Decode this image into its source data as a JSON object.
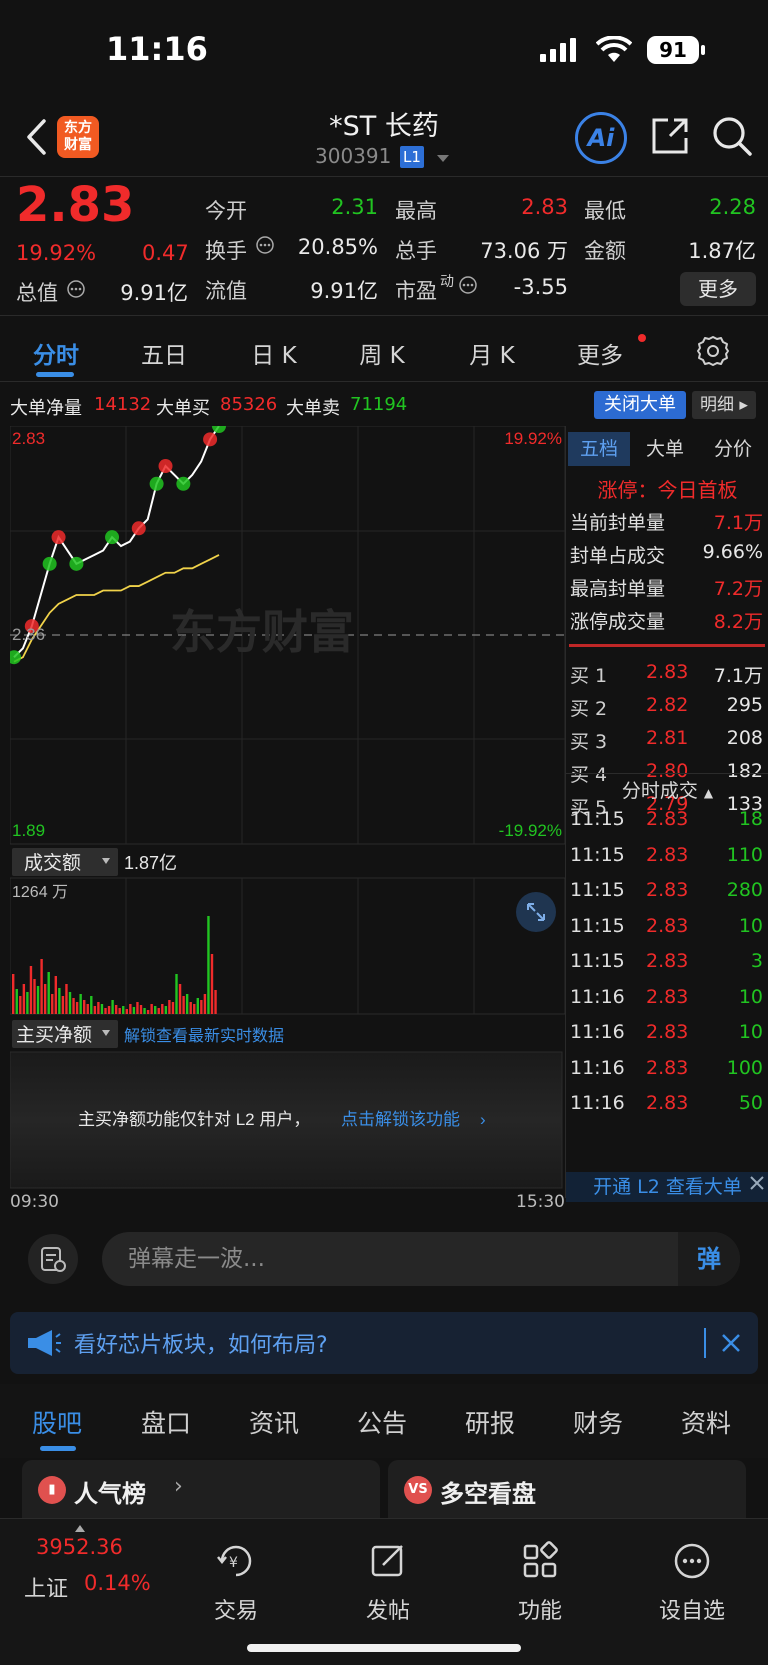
{
  "status_bar": {
    "time": "11:16",
    "battery": "91"
  },
  "header": {
    "logo_line1": "东方",
    "logo_line2": "财富",
    "stock_name": "*ST 长药",
    "stock_code": "300391",
    "level": "L1",
    "ai_label": "Ai"
  },
  "quote": {
    "price": "2.83",
    "change_pct": "19.92%",
    "change": "0.47",
    "total_value_label": "总值",
    "total_value": "9.91亿",
    "open_label": "今开",
    "open": "2.31",
    "high_label": "最高",
    "high": "2.83",
    "low_label": "最低",
    "low": "2.28",
    "turnover_label": "换手",
    "turnover": "20.85%",
    "volume_label": "总手",
    "volume": "73.06 万",
    "amount_label": "金额",
    "amount": "1.87亿",
    "float_value_label": "流值",
    "float_value": "9.91亿",
    "pe_label": "市盈",
    "pe_sup": "动",
    "pe": "-3.55",
    "more_label": "更多"
  },
  "tabs": [
    "分时",
    "五日",
    "日 K",
    "周 K",
    "月 K",
    "更多"
  ],
  "big_order": {
    "net_label": "大单净量",
    "net": "14132",
    "buy_label": "大单买",
    "buy": "85326",
    "sell_label": "大单卖",
    "sell": "71194",
    "close_label": "关闭大单",
    "detail_label": "明细"
  },
  "chart": {
    "top_price": "2.83",
    "mid_price": "2.36",
    "bottom_price": "1.89",
    "top_pct": "19.92%",
    "bottom_pct": "-19.92%",
    "watermark": "东方财富",
    "volume_selector": "成交额",
    "volume_total": "1.87亿",
    "volume_max": "1264 万",
    "net_selector": "主买净额",
    "net_unlock_link": "解锁查看最新实时数据",
    "net_locked_text": "主买净额功能仅针对 L2 用户，",
    "net_locked_link": "点击解锁该功能",
    "time_start": "09:30",
    "time_end": "15:30"
  },
  "chart_data": {
    "type": "line",
    "series": [
      {
        "name": "price",
        "values": [
          2.31,
          2.33,
          2.38,
          2.45,
          2.52,
          2.58,
          2.55,
          2.52,
          2.53,
          2.54,
          2.55,
          2.58,
          2.56,
          2.57,
          2.6,
          2.62,
          2.7,
          2.74,
          2.72,
          2.7,
          2.72,
          2.75,
          2.8,
          2.83
        ]
      },
      {
        "name": "avg",
        "values": [
          2.3,
          2.31,
          2.35,
          2.38,
          2.41,
          2.43,
          2.44,
          2.45,
          2.45,
          2.45,
          2.46,
          2.46,
          2.46,
          2.47,
          2.47,
          2.48,
          2.49,
          2.5,
          2.5,
          2.51,
          2.51,
          2.52,
          2.53,
          2.54
        ]
      }
    ],
    "ylim": [
      1.89,
      2.83
    ],
    "volume_max": "1264 万"
  },
  "order_book": {
    "tabs": [
      "五档",
      "大单",
      "分价"
    ],
    "limit_up_label": "涨停：今日首板",
    "stats": [
      {
        "label": "当前封单量",
        "value": "7.1万"
      },
      {
        "label": "封单占成交",
        "value": "9.66%"
      },
      {
        "label": "最高封单量",
        "value": "7.2万"
      },
      {
        "label": "涨停成交量",
        "value": "8.2万"
      }
    ],
    "bids": [
      {
        "label": "买 1",
        "price": "2.83",
        "volume": "7.1万"
      },
      {
        "label": "买 2",
        "price": "2.82",
        "volume": "295"
      },
      {
        "label": "买 3",
        "price": "2.81",
        "volume": "208"
      },
      {
        "label": "买 4",
        "price": "2.80",
        "volume": "182"
      },
      {
        "label": "买 5",
        "price": "2.79",
        "volume": "133"
      }
    ],
    "ticks_title": "分时成交",
    "ticks": [
      {
        "time": "11:15",
        "price": "2.83",
        "vol": "18"
      },
      {
        "time": "11:15",
        "price": "2.83",
        "vol": "110"
      },
      {
        "time": "11:15",
        "price": "2.83",
        "vol": "280"
      },
      {
        "time": "11:15",
        "price": "2.83",
        "vol": "10"
      },
      {
        "time": "11:15",
        "price": "2.83",
        "vol": "3"
      },
      {
        "time": "11:16",
        "price": "2.83",
        "vol": "10"
      },
      {
        "time": "11:16",
        "price": "2.83",
        "vol": "10"
      },
      {
        "time": "11:16",
        "price": "2.83",
        "vol": "100"
      },
      {
        "time": "11:16",
        "price": "2.83",
        "vol": "50"
      }
    ],
    "l2_promo": "开通 L2 查看大单"
  },
  "comment": {
    "placeholder": "弹幕走一波...",
    "barrage_label": "弹"
  },
  "news": {
    "text": "看好芯片板块，如何布局?"
  },
  "sub_tabs": [
    "股吧",
    "盘口",
    "资讯",
    "公告",
    "研报",
    "财务",
    "资料"
  ],
  "cards": [
    {
      "title": "人气榜"
    },
    {
      "title": "多空看盘"
    }
  ],
  "bottom_nav": {
    "index_value": "3952.36",
    "index_name": "上证",
    "index_pct": "0.14%",
    "items": [
      "交易",
      "发帖",
      "功能",
      "设自选"
    ]
  },
  "colors": {
    "up": "#f02b2b",
    "down": "#21c421",
    "accent": "#3a8ee6",
    "avg_line": "#f0d24a"
  }
}
